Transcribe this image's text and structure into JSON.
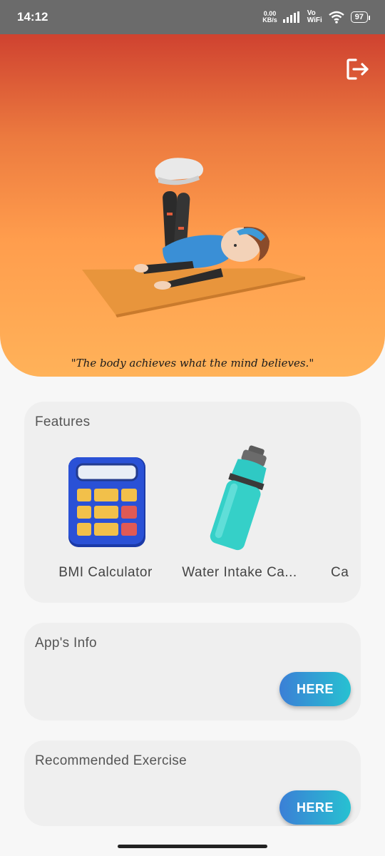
{
  "status_bar": {
    "time": "14:12",
    "network_speed_value": "0.00",
    "network_speed_unit": "KB/s",
    "vo": "Vo",
    "wifi_label": "WiFi",
    "battery": "97"
  },
  "hero": {
    "quote": "\"The body achieves what the mind believes.\"",
    "gradient_top": "#cf4230",
    "gradient_bottom": "#ffb259"
  },
  "features": {
    "title": "Features",
    "items": [
      {
        "label": "BMI Calculator",
        "icon": "calculator-icon"
      },
      {
        "label": "Water Intake Ca...",
        "icon": "water-bottle-icon"
      },
      {
        "label": "Ca",
        "icon": "partial-icon"
      }
    ]
  },
  "app_info": {
    "title": "App's Info",
    "button_label": "HERE"
  },
  "recommended_exercise": {
    "title": "Recommended Exercise",
    "button_label": "HERE"
  },
  "colors": {
    "accent_start": "#3b7fd6",
    "accent_end": "#27c1d1",
    "card_bg": "#efefef"
  }
}
